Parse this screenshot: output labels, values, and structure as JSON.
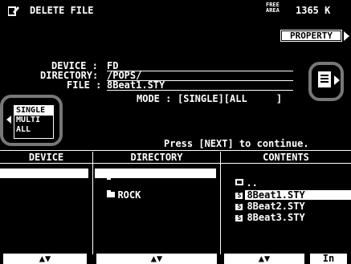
{
  "header": {
    "title": "DELETE FILE",
    "free_area_label": "FREE\nAREA",
    "free_area_value": "1365 K",
    "property_button": "PROPERTY"
  },
  "info": {
    "device_label": "DEVICE :",
    "device_value": "FD",
    "directory_label": "DIRECTORY:",
    "directory_value": "/POPS/",
    "file_label": "FILE :",
    "file_value": "8Beat1.STY",
    "mode_label": "MODE :",
    "mode_value": "[SINGLE][ALL     ]"
  },
  "mode_selector": {
    "options": [
      "SINGLE",
      "MULTI",
      "ALL"
    ]
  },
  "hint": "Press [NEXT] to continue.",
  "columns": {
    "device": "DEVICE",
    "directory": "DIRECTORY",
    "contents": "CONTENTS"
  },
  "device_list": [
    "FD"
  ],
  "directory_list": [
    "POPS",
    "ROCK"
  ],
  "contents_list": [
    "..",
    "8Beat1.STY",
    "8Beat2.STY",
    "8Beat3.STY"
  ],
  "footer": {
    "scroll_label": "▲▼",
    "in_label": "In"
  },
  "colors": {
    "background": "#000000",
    "foreground": "#ffffff",
    "highlight_ring": "#777777"
  }
}
